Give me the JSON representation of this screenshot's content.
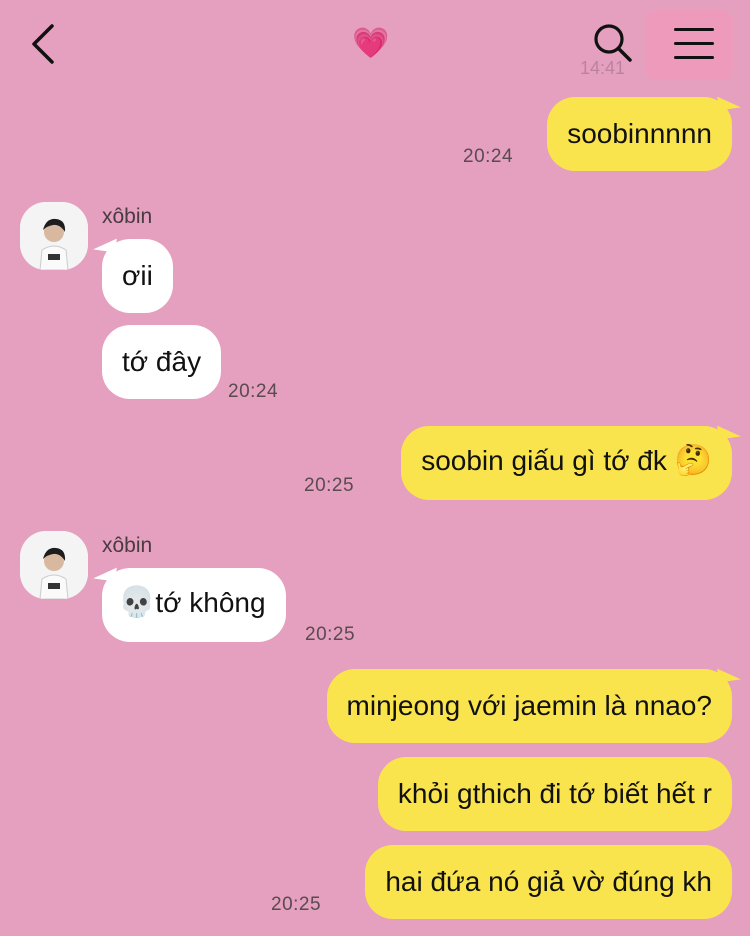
{
  "header": {
    "title_emoji": "💗",
    "ghost_time": "14:41",
    "back_icon": "chevron-left-icon",
    "search_icon": "search-icon",
    "menu_icon": "hamburger-menu-icon"
  },
  "contact": {
    "name": "xôbin"
  },
  "messages": [
    {
      "side": "out",
      "text": "soobinnnnn",
      "time": "20:24"
    },
    {
      "side": "in",
      "text": "ơii"
    },
    {
      "side": "in",
      "text": "tớ đây",
      "time": "20:24"
    },
    {
      "side": "out",
      "text": "soobin giấu gì tớ đk",
      "emoji": "🤔",
      "time": "20:25"
    },
    {
      "side": "in",
      "emoji": "💀",
      "text": "tớ không",
      "time": "20:25"
    },
    {
      "side": "out",
      "text": "minjeong với jaemin là nnao?"
    },
    {
      "side": "out",
      "text": "khỏi gthich đi tớ biết hết r"
    },
    {
      "side": "out",
      "text": "hai đứa nó giả vờ đúng kh",
      "time": "20:25"
    }
  ],
  "colors": {
    "background": "#e59fbf",
    "outgoing_bubble": "#fae44d",
    "incoming_bubble": "#ffffff"
  }
}
